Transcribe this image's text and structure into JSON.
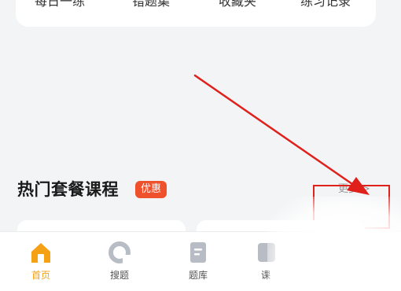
{
  "quick_links": {
    "items": [
      {
        "label": "每日一练"
      },
      {
        "label": "错题集"
      },
      {
        "label": "收藏夹"
      },
      {
        "label": "练习记录"
      }
    ]
  },
  "section": {
    "title": "热门套餐课程",
    "badge": "优惠",
    "more_label": "更多",
    "more_chevron": ">"
  },
  "tab_bar": {
    "items": [
      {
        "label": "首页",
        "icon": "home-icon",
        "active": true
      },
      {
        "label": "搜题",
        "icon": "search-question-icon",
        "active": false
      },
      {
        "label": "题库",
        "icon": "question-bank-icon",
        "active": false
      },
      {
        "label": "课",
        "icon": "course-icon",
        "active": false
      }
    ]
  },
  "colors": {
    "accent": "#f5a115",
    "badge": "#f0512d",
    "annotation": "#e0201b",
    "background": "#f3f4f6"
  }
}
